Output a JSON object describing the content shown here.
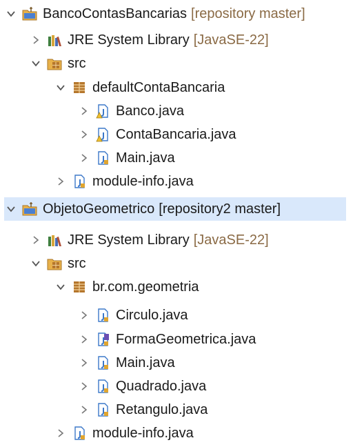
{
  "tree": {
    "projects": [
      {
        "name": "BancoContasBancarias",
        "decoration": "[repository master]",
        "jre": {
          "label": "JRE System Library",
          "decoration": "[JavaSE-22]"
        },
        "src": "src",
        "package": "defaultContaBancaria",
        "files": [
          "Banco.java",
          "ContaBancaria.java",
          "Main.java"
        ],
        "module": "module-info.java"
      },
      {
        "name": "ObjetoGeometrico",
        "decoration": "[repository2 master]",
        "jre": {
          "label": "JRE System Library",
          "decoration": "[JavaSE-22]"
        },
        "src": "src",
        "package": "br.com.geometria",
        "files": [
          "Circulo.java",
          "FormaGeometrica.java",
          "Main.java",
          "Quadrado.java",
          "Retangulo.java"
        ],
        "module": "module-info.java"
      }
    ]
  },
  "colors": {
    "selection": "#d9e8fb",
    "decoration": "#8a6a45",
    "folder": "#e8b14a",
    "java_file": "#3c78c9",
    "package": "#b5762c"
  }
}
